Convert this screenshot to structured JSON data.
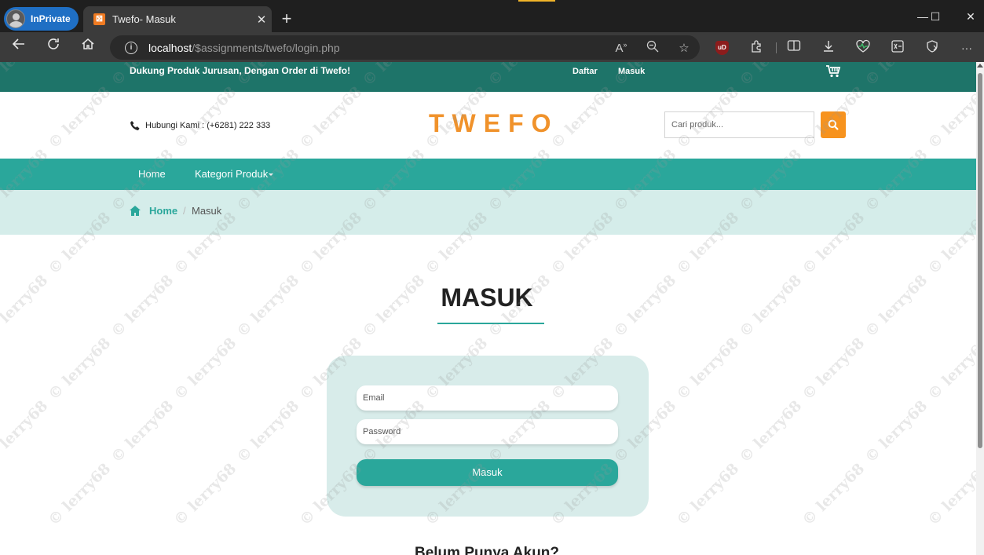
{
  "browser": {
    "inprivate_label": "InPrivate",
    "tab_title": "Twefo- Masuk",
    "tab_close": "✕",
    "new_tab": "+",
    "url_host": "localhost",
    "url_path": "/$assignments/twefo/login.php",
    "window_controls": [
      "—",
      "☐",
      "✕"
    ]
  },
  "topbar": {
    "promo": "Dukung Produk Jurusan, Dengan Order di Twefo!",
    "register": "Daftar",
    "login": "Masuk"
  },
  "header": {
    "contact": "Hubungi Kami : (+6281) 222 333",
    "logo": "TWEFO",
    "search_placeholder": "Cari produk..."
  },
  "nav": {
    "home": "Home",
    "categories": "Kategori Produk"
  },
  "breadcrumb": {
    "home": "Home",
    "separator": "/",
    "current": "Masuk"
  },
  "login": {
    "title": "MASUK",
    "email_placeholder": "Email",
    "password_placeholder": "Password",
    "submit": "Masuk",
    "no_account": "Belum Punya Akun?"
  },
  "watermark": "© lerry68",
  "colors": {
    "topstrip": "#1e7469",
    "teal": "#2aa79b",
    "crumb_bg": "#d5edea",
    "card_bg": "#d8ecea",
    "logo": "#f0922b",
    "search_button": "#f7931e"
  },
  "icons": {
    "phone": "phone-icon",
    "cart": "cart-icon",
    "search": "search-icon",
    "home": "home-icon"
  }
}
